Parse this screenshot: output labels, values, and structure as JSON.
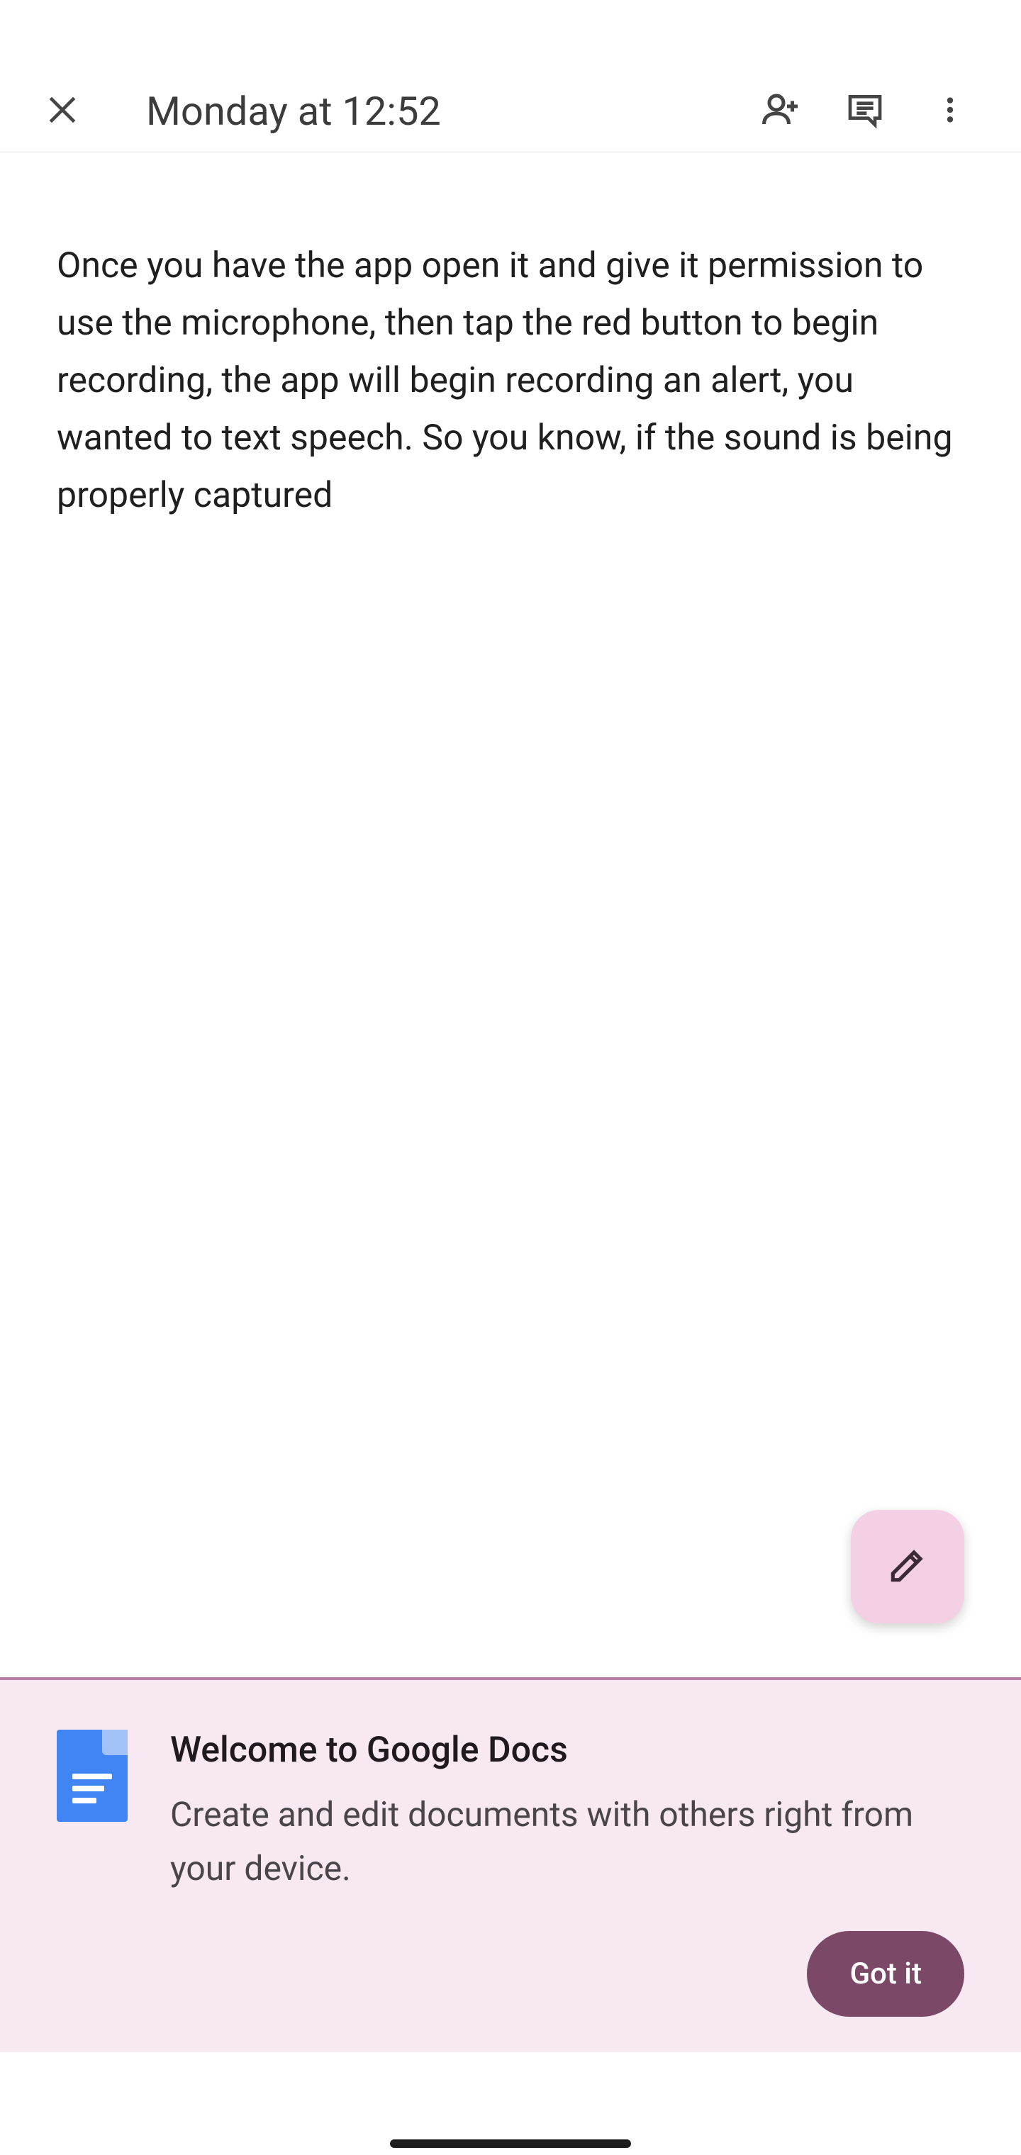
{
  "header": {
    "title": "Monday at 12:52"
  },
  "document": {
    "body": "Once you have the app open it and give it permission to use the microphone, then tap the red button to begin recording, the app will begin recording an alert, you wanted to text speech. So you know, if the sound is being properly captured"
  },
  "welcome": {
    "title": "Welcome to Google Docs",
    "description": "Create and edit documents with others right from your device.",
    "cta": "Got it"
  },
  "icons": {
    "close": "close-icon",
    "add_person": "add-person-icon",
    "comments": "comments-icon",
    "more": "more-vert-icon",
    "edit": "pencil-icon",
    "docs": "docs-app-icon"
  }
}
